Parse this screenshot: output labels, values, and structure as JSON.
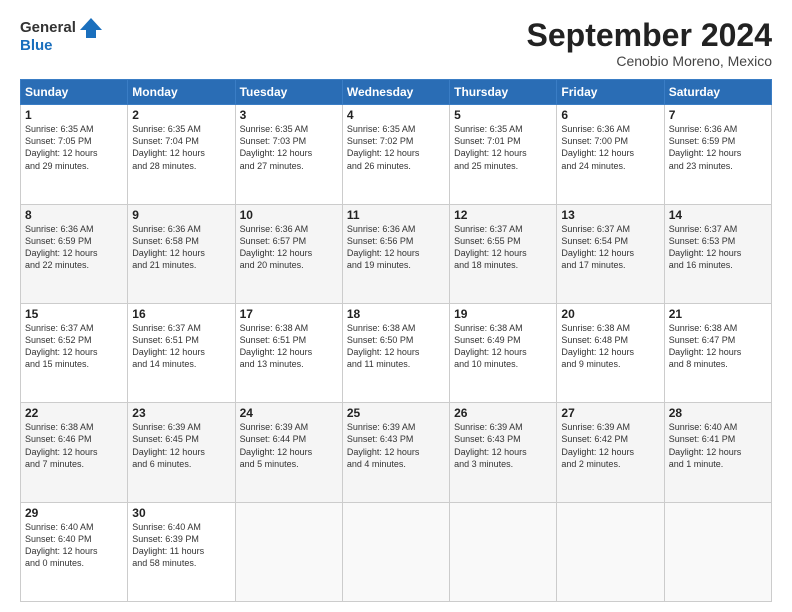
{
  "header": {
    "logo_line1": "General",
    "logo_line2": "Blue",
    "month": "September 2024",
    "location": "Cenobio Moreno, Mexico"
  },
  "weekdays": [
    "Sunday",
    "Monday",
    "Tuesday",
    "Wednesday",
    "Thursday",
    "Friday",
    "Saturday"
  ],
  "weeks": [
    [
      {
        "day": "1",
        "info": "Sunrise: 6:35 AM\nSunset: 7:05 PM\nDaylight: 12 hours\nand 29 minutes."
      },
      {
        "day": "2",
        "info": "Sunrise: 6:35 AM\nSunset: 7:04 PM\nDaylight: 12 hours\nand 28 minutes."
      },
      {
        "day": "3",
        "info": "Sunrise: 6:35 AM\nSunset: 7:03 PM\nDaylight: 12 hours\nand 27 minutes."
      },
      {
        "day": "4",
        "info": "Sunrise: 6:35 AM\nSunset: 7:02 PM\nDaylight: 12 hours\nand 26 minutes."
      },
      {
        "day": "5",
        "info": "Sunrise: 6:35 AM\nSunset: 7:01 PM\nDaylight: 12 hours\nand 25 minutes."
      },
      {
        "day": "6",
        "info": "Sunrise: 6:36 AM\nSunset: 7:00 PM\nDaylight: 12 hours\nand 24 minutes."
      },
      {
        "day": "7",
        "info": "Sunrise: 6:36 AM\nSunset: 6:59 PM\nDaylight: 12 hours\nand 23 minutes."
      }
    ],
    [
      {
        "day": "8",
        "info": "Sunrise: 6:36 AM\nSunset: 6:59 PM\nDaylight: 12 hours\nand 22 minutes."
      },
      {
        "day": "9",
        "info": "Sunrise: 6:36 AM\nSunset: 6:58 PM\nDaylight: 12 hours\nand 21 minutes."
      },
      {
        "day": "10",
        "info": "Sunrise: 6:36 AM\nSunset: 6:57 PM\nDaylight: 12 hours\nand 20 minutes."
      },
      {
        "day": "11",
        "info": "Sunrise: 6:36 AM\nSunset: 6:56 PM\nDaylight: 12 hours\nand 19 minutes."
      },
      {
        "day": "12",
        "info": "Sunrise: 6:37 AM\nSunset: 6:55 PM\nDaylight: 12 hours\nand 18 minutes."
      },
      {
        "day": "13",
        "info": "Sunrise: 6:37 AM\nSunset: 6:54 PM\nDaylight: 12 hours\nand 17 minutes."
      },
      {
        "day": "14",
        "info": "Sunrise: 6:37 AM\nSunset: 6:53 PM\nDaylight: 12 hours\nand 16 minutes."
      }
    ],
    [
      {
        "day": "15",
        "info": "Sunrise: 6:37 AM\nSunset: 6:52 PM\nDaylight: 12 hours\nand 15 minutes."
      },
      {
        "day": "16",
        "info": "Sunrise: 6:37 AM\nSunset: 6:51 PM\nDaylight: 12 hours\nand 14 minutes."
      },
      {
        "day": "17",
        "info": "Sunrise: 6:38 AM\nSunset: 6:51 PM\nDaylight: 12 hours\nand 13 minutes."
      },
      {
        "day": "18",
        "info": "Sunrise: 6:38 AM\nSunset: 6:50 PM\nDaylight: 12 hours\nand 11 minutes."
      },
      {
        "day": "19",
        "info": "Sunrise: 6:38 AM\nSunset: 6:49 PM\nDaylight: 12 hours\nand 10 minutes."
      },
      {
        "day": "20",
        "info": "Sunrise: 6:38 AM\nSunset: 6:48 PM\nDaylight: 12 hours\nand 9 minutes."
      },
      {
        "day": "21",
        "info": "Sunrise: 6:38 AM\nSunset: 6:47 PM\nDaylight: 12 hours\nand 8 minutes."
      }
    ],
    [
      {
        "day": "22",
        "info": "Sunrise: 6:38 AM\nSunset: 6:46 PM\nDaylight: 12 hours\nand 7 minutes."
      },
      {
        "day": "23",
        "info": "Sunrise: 6:39 AM\nSunset: 6:45 PM\nDaylight: 12 hours\nand 6 minutes."
      },
      {
        "day": "24",
        "info": "Sunrise: 6:39 AM\nSunset: 6:44 PM\nDaylight: 12 hours\nand 5 minutes."
      },
      {
        "day": "25",
        "info": "Sunrise: 6:39 AM\nSunset: 6:43 PM\nDaylight: 12 hours\nand 4 minutes."
      },
      {
        "day": "26",
        "info": "Sunrise: 6:39 AM\nSunset: 6:43 PM\nDaylight: 12 hours\nand 3 minutes."
      },
      {
        "day": "27",
        "info": "Sunrise: 6:39 AM\nSunset: 6:42 PM\nDaylight: 12 hours\nand 2 minutes."
      },
      {
        "day": "28",
        "info": "Sunrise: 6:40 AM\nSunset: 6:41 PM\nDaylight: 12 hours\nand 1 minute."
      }
    ],
    [
      {
        "day": "29",
        "info": "Sunrise: 6:40 AM\nSunset: 6:40 PM\nDaylight: 12 hours\nand 0 minutes."
      },
      {
        "day": "30",
        "info": "Sunrise: 6:40 AM\nSunset: 6:39 PM\nDaylight: 11 hours\nand 58 minutes."
      },
      {
        "day": "",
        "info": ""
      },
      {
        "day": "",
        "info": ""
      },
      {
        "day": "",
        "info": ""
      },
      {
        "day": "",
        "info": ""
      },
      {
        "day": "",
        "info": ""
      }
    ]
  ]
}
